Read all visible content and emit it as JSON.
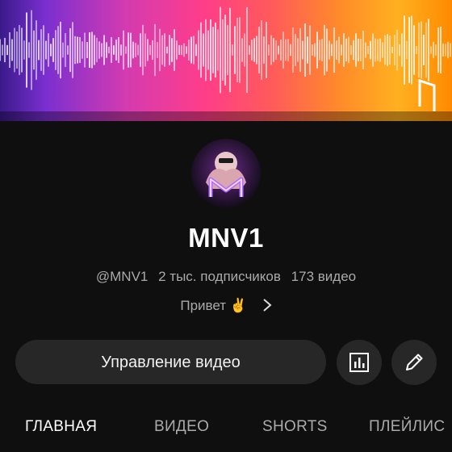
{
  "channel": {
    "name": "MNV1",
    "handle": "@MNV1",
    "subscribers": "2 тыс. подписчиков",
    "videos": "173 видео",
    "description": "Привет ✌️"
  },
  "actions": {
    "manage_label": "Управление видео",
    "analytics_icon": "bar-chart-icon",
    "edit_icon": "pencil-icon"
  },
  "tabs": [
    {
      "label": "ГЛАВНАЯ",
      "active": true
    },
    {
      "label": "ВИДЕО",
      "active": false
    },
    {
      "label": "SHORTS",
      "active": false
    },
    {
      "label": "ПЛЕЙЛИС",
      "active": false
    }
  ],
  "colors": {
    "background": "#0f0f0f",
    "button": "#272727",
    "secondary_text": "#aaaaaa",
    "avatar_glow": "#a855f7"
  }
}
